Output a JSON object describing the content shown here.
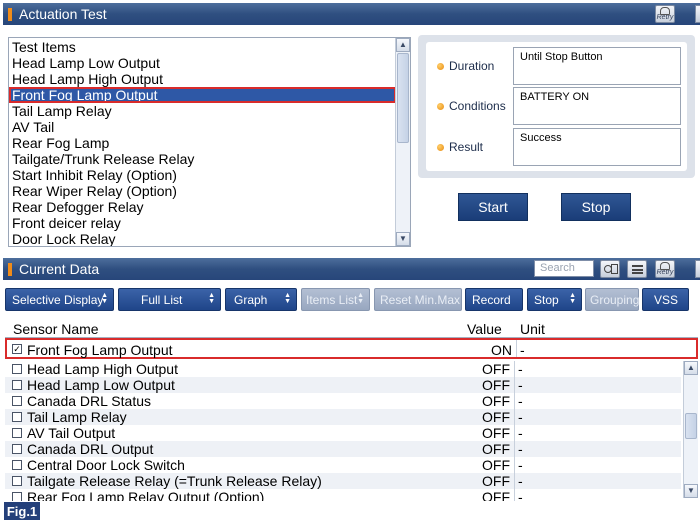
{
  "actuation": {
    "title": "Actuation Test",
    "retry_label": "Retry",
    "list_header": "Test Items",
    "items": [
      "Head Lamp Low Output",
      "Head Lamp High Output",
      "Front Fog Lamp Output",
      "Tail Lamp Relay",
      "AV Tail",
      "Rear Fog Lamp",
      "Tailgate/Trunk Release Relay",
      "Start Inhibit Relay (Option)",
      "Rear Wiper Relay (Option)",
      "Rear Defogger Relay",
      "Front deicer relay",
      "Door Lock Relay"
    ],
    "selected_item": "Front Fog Lamp Output",
    "info": {
      "duration_label": "Duration",
      "duration_value": "Until Stop Button",
      "conditions_label": "Conditions",
      "conditions_value": "BATTERY ON",
      "result_label": "Result",
      "result_value": "Success"
    },
    "start_label": "Start",
    "stop_label": "Stop"
  },
  "current": {
    "title": "Current Data",
    "search_placeholder": "Search",
    "retry_label": "Retry",
    "toolbar": {
      "selective_display": "Selective Display",
      "full_list": "Full List",
      "graph": "Graph",
      "items_list": "Items List",
      "reset_min_max": "Reset Min.Max",
      "record": "Record",
      "stop": "Stop",
      "grouping": "Grouping",
      "vss": "VSS"
    },
    "columns": {
      "sensor_name": "Sensor Name",
      "value": "Value",
      "unit": "Unit"
    },
    "pinned_row": {
      "name": "Front Fog Lamp Output",
      "value": "ON",
      "unit": "-",
      "checked": true
    },
    "rows": [
      {
        "name": "Head Lamp High Output",
        "value": "OFF",
        "unit": "-"
      },
      {
        "name": "Head Lamp Low Output",
        "value": "OFF",
        "unit": "-"
      },
      {
        "name": "Canada DRL Status",
        "value": "OFF",
        "unit": "-"
      },
      {
        "name": "Tail Lamp Relay",
        "value": "OFF",
        "unit": "-"
      },
      {
        "name": "AV Tail Output",
        "value": "OFF",
        "unit": "-"
      },
      {
        "name": "Canada DRL Output",
        "value": "OFF",
        "unit": "-"
      },
      {
        "name": "Central Door Lock Switch",
        "value": "OFF",
        "unit": "-"
      },
      {
        "name": "Tailgate Release Relay (=Trunk Release Relay)",
        "value": "OFF",
        "unit": "-"
      },
      {
        "name": "Rear Fog Lamp Relay Output (Option)",
        "value": "OFF",
        "unit": "-"
      }
    ]
  },
  "figure_label": "Fig.1",
  "colors": {
    "header_bar": "#2f4f80",
    "accent_orange": "#f08c1a",
    "selection_blue": "#2e58a6",
    "highlight_red": "#d92b2b",
    "button_blue": "#1f4589"
  }
}
